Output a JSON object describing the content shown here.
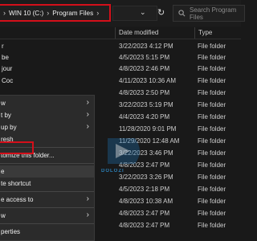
{
  "address_bar": {
    "crumbs": [
      "WIN 10 (C:)",
      "Program Files"
    ],
    "search_placeholder": "Search Program Files"
  },
  "columns": {
    "date": "Date modified",
    "type": "Type"
  },
  "rows": [
    {
      "name": "r",
      "date": "3/22/2023 4:12 PM",
      "type": "File folder"
    },
    {
      "name": "be",
      "date": "4/5/2023 5:15 PM",
      "type": "File folder"
    },
    {
      "name": "jour",
      "date": "4/8/2023 2:46 PM",
      "type": "File folder"
    },
    {
      "name": "Coc",
      "date": "4/11/2023 10:36 AM",
      "type": "File folder"
    },
    {
      "name": "",
      "date": "4/8/2023 2:50 PM",
      "type": "File folder"
    },
    {
      "name": "",
      "date": "3/22/2023 5:19 PM",
      "type": "File folder"
    },
    {
      "name": "",
      "date": "4/4/2023 4:20 PM",
      "type": "File folder"
    },
    {
      "name": "",
      "date": "11/28/2020 9:01 PM",
      "type": "File folder"
    },
    {
      "name": "",
      "date": "11/29/2020 12:48 AM",
      "type": "File folder"
    },
    {
      "name": "",
      "date": "3/22/2023 3:46 PM",
      "type": "File folder"
    },
    {
      "name": "",
      "date": "4/8/2023 2:47 PM",
      "type": "File folder"
    },
    {
      "name": "",
      "date": "3/22/2023 3:26 PM",
      "type": "File folder"
    },
    {
      "name": "",
      "date": "4/5/2023 2:18 PM",
      "type": "File folder"
    },
    {
      "name": "",
      "date": "4/8/2023 10:38 AM",
      "type": "File folder"
    },
    {
      "name": "",
      "date": "4/8/2023 2:47 PM",
      "type": "File folder"
    },
    {
      "name": "",
      "date": "4/8/2023 2:47 PM",
      "type": "File folder"
    }
  ],
  "context_menu": {
    "items": [
      {
        "label": "w"
      },
      {
        "label": "t by"
      },
      {
        "label": "up by"
      },
      {
        "label": "resh"
      },
      {
        "label": "tomize this folder..."
      },
      {
        "label": "e"
      },
      {
        "label": "te shortcut"
      },
      {
        "label": "e access to"
      },
      {
        "label": "w"
      },
      {
        "label": "perties"
      }
    ]
  },
  "watermark": {
    "text": "DOLOZI"
  },
  "colors": {
    "highlight": "#d40f1a",
    "background": "#191919",
    "menu": "#2b2b2b"
  }
}
